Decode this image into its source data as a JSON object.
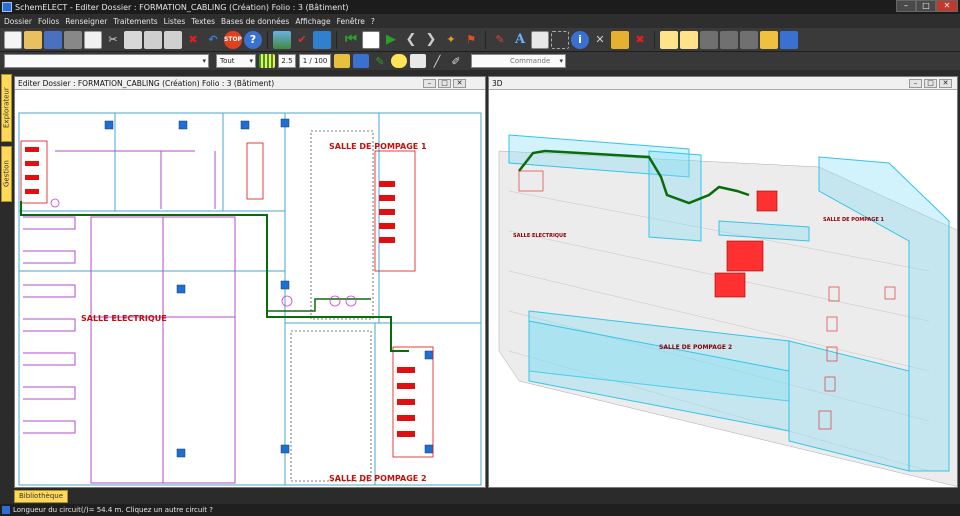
{
  "window": {
    "title": "SchemELECT - Editer Dossier : FORMATION_CABLING  (Création)  Folio : 3  (Bâtiment)"
  },
  "menu": [
    "Dossier",
    "Folios",
    "Renseigner",
    "Traitements",
    "Listes",
    "Textes",
    "Bases de données",
    "Affichage",
    "Fenêtre",
    "?"
  ],
  "toolbar2": {
    "filter_value": "Tout",
    "thickness_value": "2.5",
    "scale_value": "1 / 100",
    "command_placeholder": "Commande"
  },
  "sidebar": {
    "tab1": "Explorateur",
    "tab2": "Gestion"
  },
  "plan_pane": {
    "title": "Editer  Dossier : FORMATION_CABLING  (Création)  Folio : 3  (Bâtiment)",
    "room1": "SALLE DE POMPAGE 1",
    "room2": "SALLE DE POMPAGE 2",
    "room3": "SALLE ELECTRIQUE"
  },
  "view3d_pane": {
    "title": "3D",
    "label1": "SALLE DE POMPAGE 2",
    "label2": "SALLE ELECTRIQUE",
    "label3": "SALLE DE POMPAGE 1"
  },
  "bottom": {
    "library_tab": "Bibliothèque"
  },
  "status": {
    "message": "Longueur du circuit(/)= 54.4 m. Cliquez un autre circuit ?"
  },
  "colors": {
    "accent": "#ffd95a",
    "cable": "#0a6b0a",
    "equipment": "#e01010",
    "wall3d": "#35c4e8"
  }
}
